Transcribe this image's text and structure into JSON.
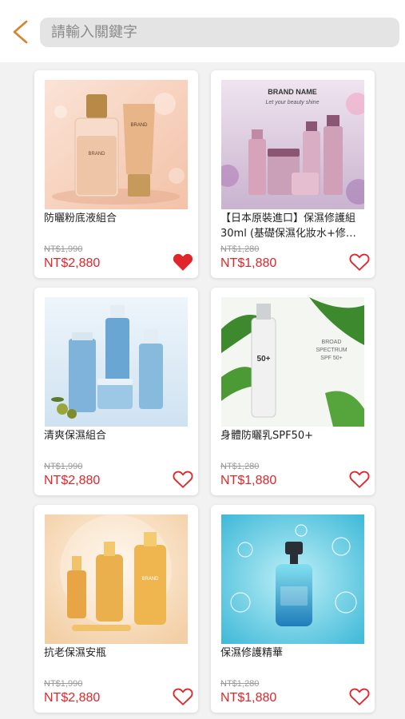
{
  "search": {
    "placeholder": "請輸入關鍵字"
  },
  "colors": {
    "accent": "#d9822b",
    "price": "#e0262b",
    "heart": "#e0262b"
  },
  "products": [
    {
      "name": "防曬粉底液組合",
      "old_price": "NT$1,990",
      "price": "NT$2,880",
      "favorite": true,
      "image_text": [
        "BRAND",
        "BRAND"
      ]
    },
    {
      "name": "【日本原裝進口】保濕修護組30ml (基礎保濕化妝水+修…",
      "old_price": "NT$1,280",
      "price": "NT$1,880",
      "favorite": false,
      "image_text": [
        "BRAND NAME",
        "Let your beauty shine"
      ]
    },
    {
      "name": "清爽保濕組合",
      "old_price": "NT$1,990",
      "price": "NT$2,880",
      "favorite": false,
      "image_text": []
    },
    {
      "name": "身體防曬乳SPF50+",
      "old_price": "NT$1,280",
      "price": "NT$1,880",
      "favorite": false,
      "image_text": [
        "BROAD",
        "SPECTRUM",
        "SPF 50+",
        "50+"
      ]
    },
    {
      "name": "抗老保濕安瓶",
      "old_price": "NT$1,990",
      "price": "NT$2,880",
      "favorite": false,
      "image_text": [
        "BRAND"
      ]
    },
    {
      "name": "保濕修護精華",
      "old_price": "NT$1,280",
      "price": "NT$1,880",
      "favorite": false,
      "image_text": []
    }
  ]
}
